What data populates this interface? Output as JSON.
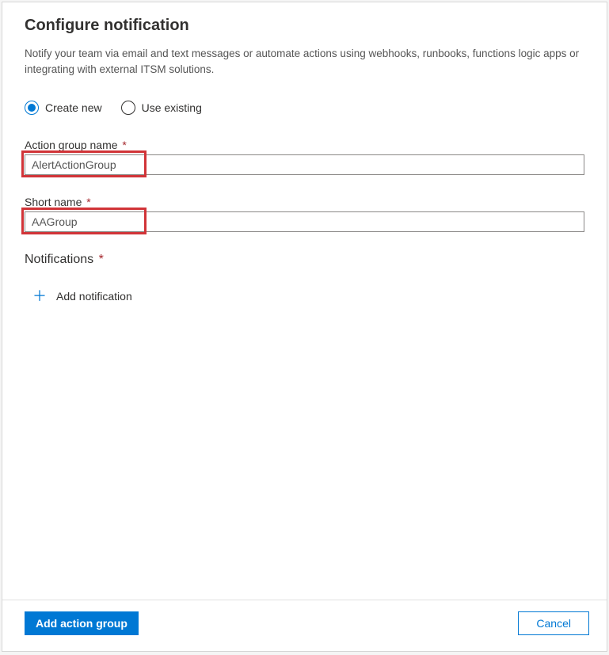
{
  "header": {
    "title": "Configure notification",
    "description": "Notify your team via email and text messages or automate actions using webhooks, runbooks, functions logic apps or integrating with external ITSM solutions."
  },
  "radio": {
    "create_new_label": "Create new",
    "use_existing_label": "Use existing",
    "selected": "create_new"
  },
  "fields": {
    "action_group_name": {
      "label": "Action group name",
      "value": "AlertActionGroup",
      "required": true
    },
    "short_name": {
      "label": "Short name",
      "value": "AAGroup",
      "required": true
    }
  },
  "notifications": {
    "heading": "Notifications",
    "required": true,
    "add_label": "Add notification"
  },
  "footer": {
    "primary_label": "Add action group",
    "secondary_label": "Cancel"
  },
  "asterisk": "*"
}
